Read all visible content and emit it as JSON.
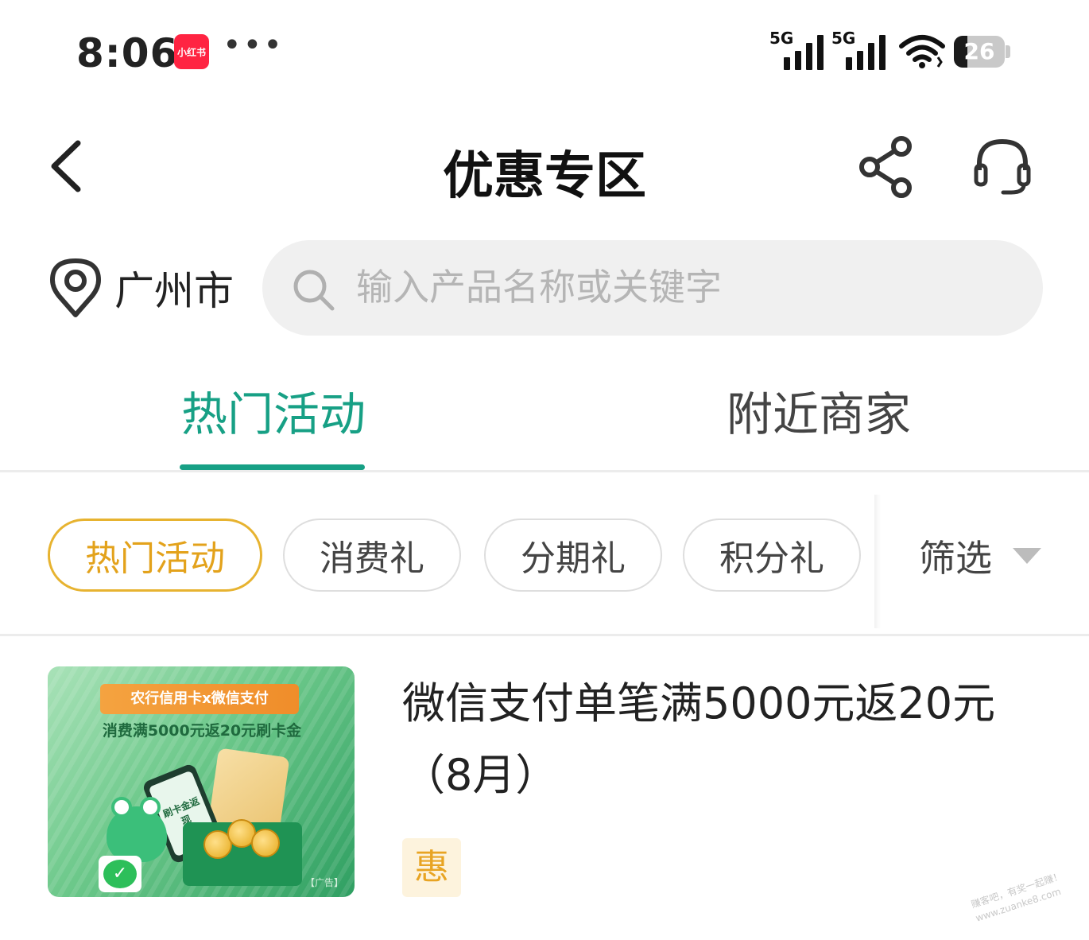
{
  "status_bar": {
    "time": "8:06",
    "app_badge": "小红书",
    "more": "•••",
    "signal_1_label": "5G",
    "signal_2_label": "5G",
    "battery_percent": "26",
    "battery_level": 0.26
  },
  "nav": {
    "title": "优惠专区",
    "icons": [
      "back-arrow-icon",
      "share-icon",
      "headset-icon"
    ]
  },
  "location": {
    "city": "广州市"
  },
  "search": {
    "placeholder": "输入产品名称或关键字",
    "value": ""
  },
  "main_tabs": [
    {
      "label": "热门活动",
      "active": true
    },
    {
      "label": "附近商家",
      "active": false
    }
  ],
  "filters": {
    "chips": [
      {
        "label": "热门活动",
        "active": true
      },
      {
        "label": "消费礼",
        "active": false
      },
      {
        "label": "分期礼",
        "active": false
      },
      {
        "label": "积分礼",
        "active": false
      }
    ],
    "filter_label": "筛选"
  },
  "activities": [
    {
      "title": "微信支付单笔满5000元返20元（8月）",
      "badge": "惠",
      "image": {
        "banner": "农行信用卡x微信支付",
        "subtitle": "消费满5000元返20元刷卡金",
        "phone_text": "刷卡金返现",
        "ad_label": "【广告】"
      }
    }
  ],
  "watermark": {
    "line1": "赚客吧，有奖一起赚！",
    "line2": "www.zuanke8.com"
  },
  "colors": {
    "accent_green": "#17a085",
    "chip_active": "#e7b330",
    "badge_orange": "#e8a423"
  }
}
